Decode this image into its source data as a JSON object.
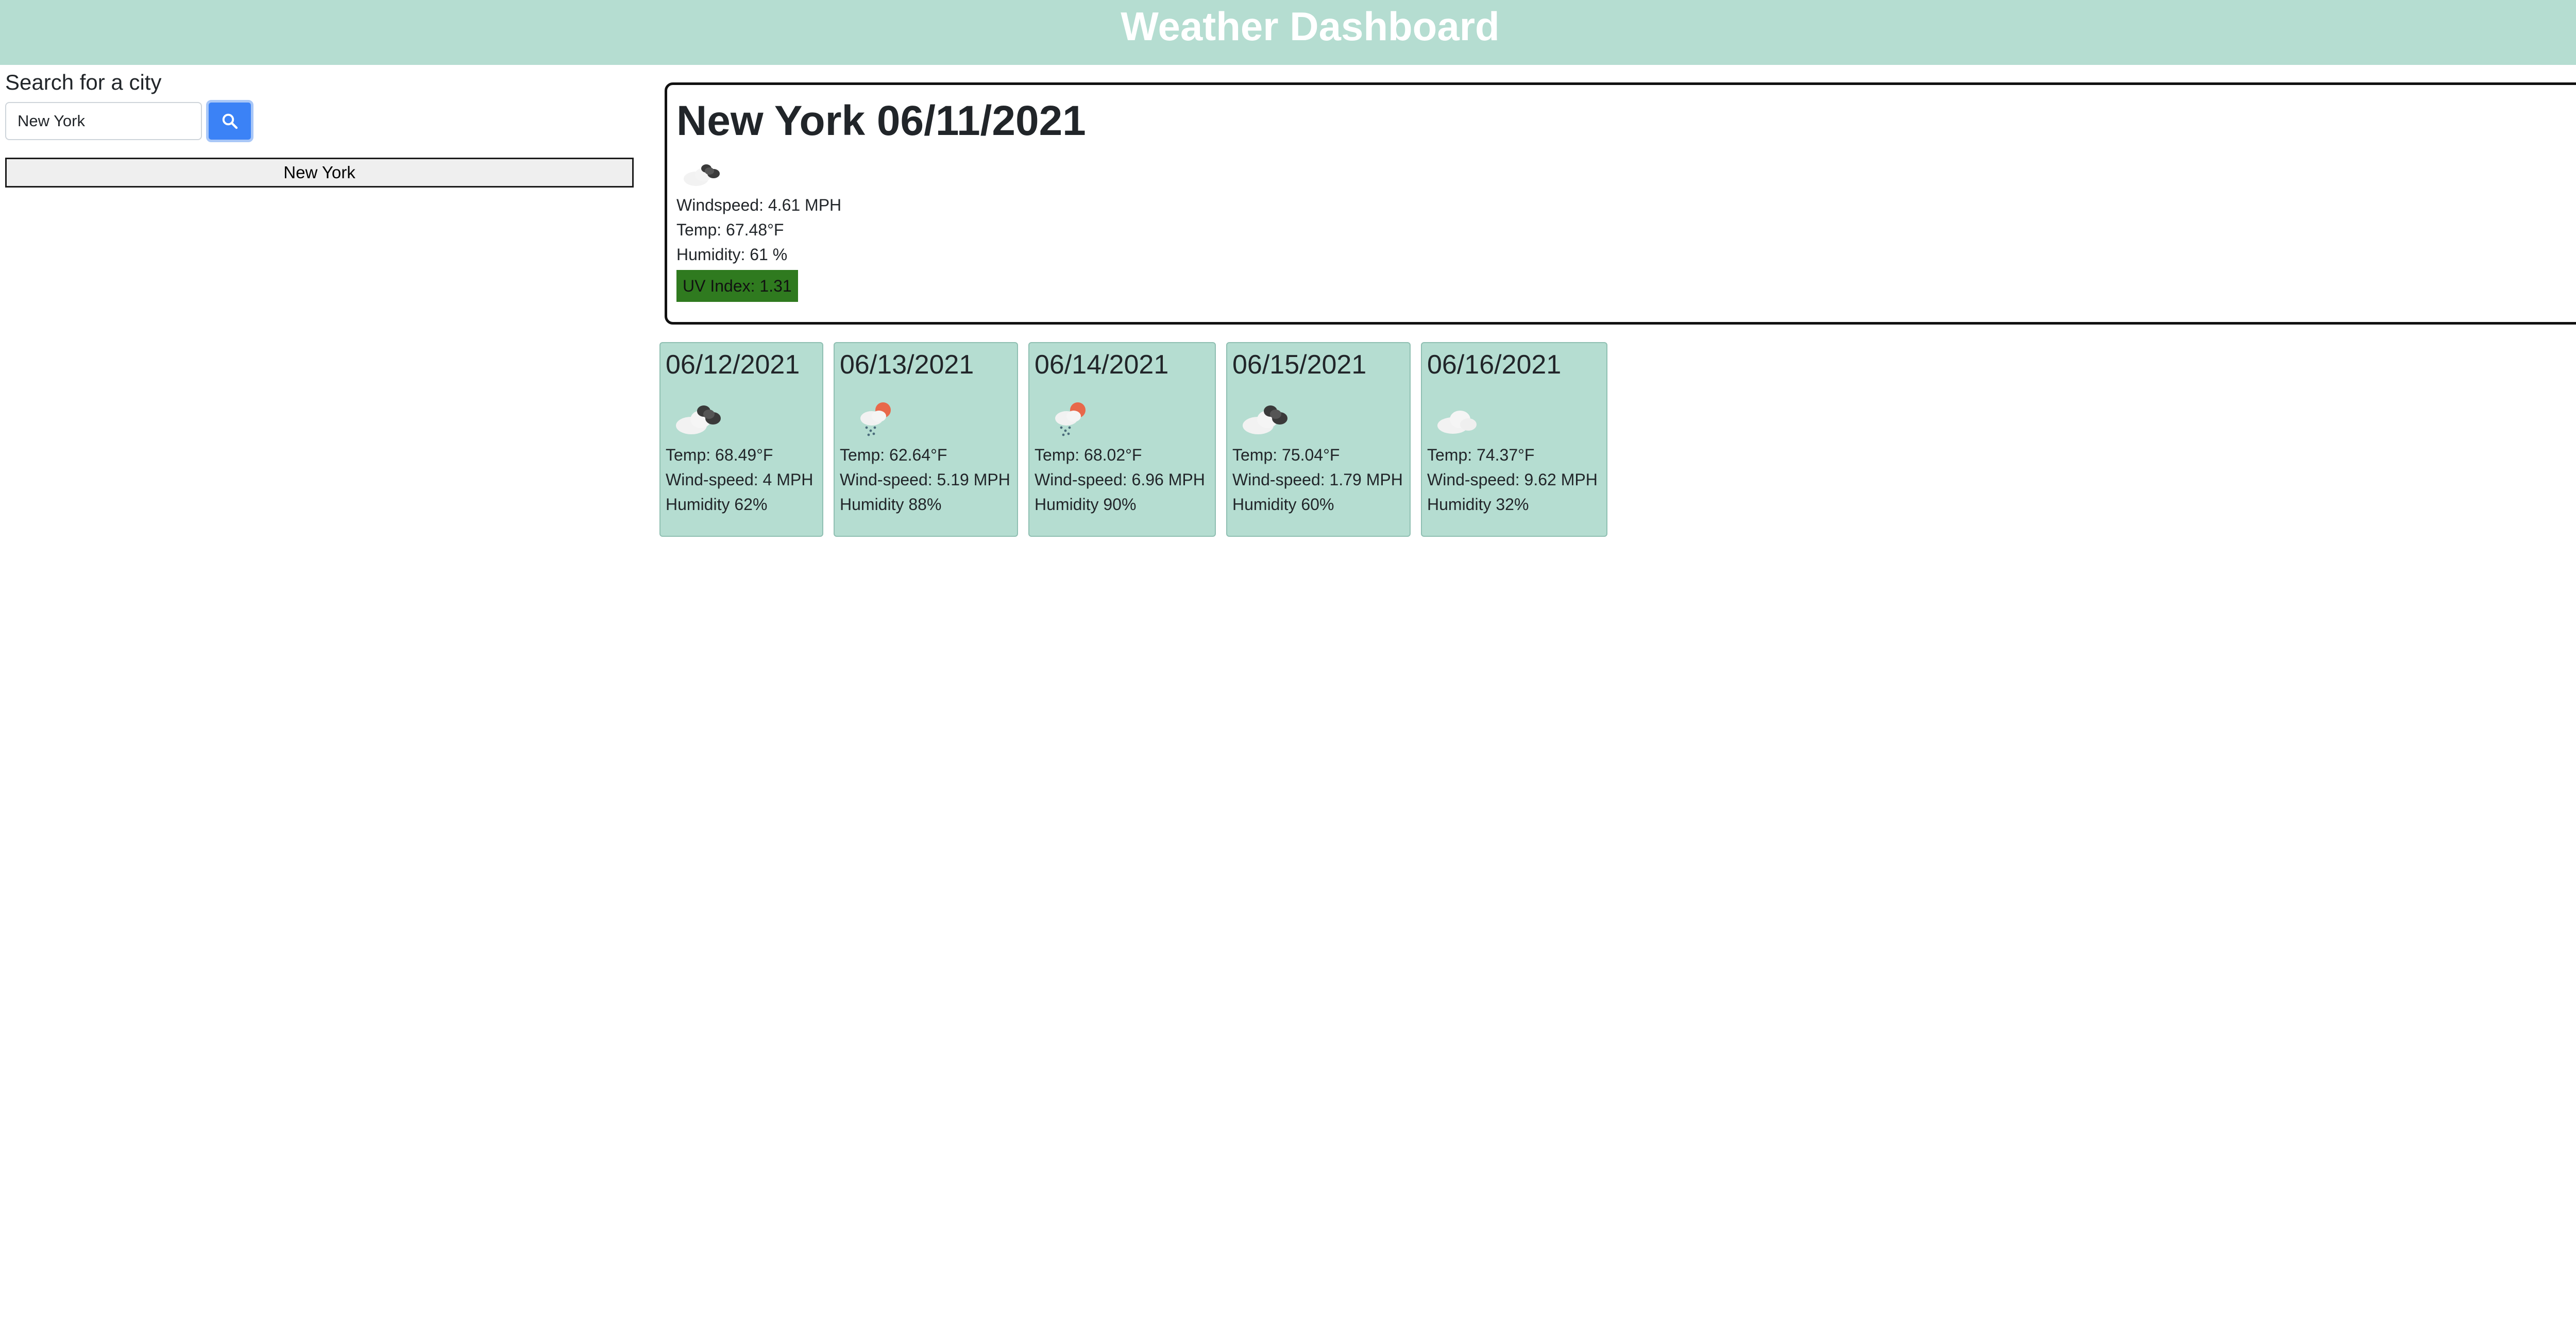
{
  "header": {
    "title": "Weather Dashboard"
  },
  "sidebar": {
    "search_label": "Search for a city",
    "search_value": "New York",
    "search_button_icon": "search-icon",
    "history": [
      "New York"
    ]
  },
  "current": {
    "title": "New York 06/11/2021",
    "icon": "cloudy-icon",
    "windspeed": "Windspeed: 4.61 MPH",
    "temp": "Temp: 67.48°F",
    "humidity": "Humidity: 61 %",
    "uv": "UV Index: 1.31",
    "uv_color": "#2f7a1f"
  },
  "forecast": [
    {
      "date": "06/12/2021",
      "icon": "broken-clouds-icon",
      "temp": "Temp: 68.49°F",
      "wind": "Wind-speed: 4 MPH",
      "humidity": "Humidity 62%"
    },
    {
      "date": "06/13/2021",
      "icon": "rain-sun-icon",
      "temp": "Temp: 62.64°F",
      "wind": "Wind-speed: 5.19 MPH",
      "humidity": "Humidity 88%"
    },
    {
      "date": "06/14/2021",
      "icon": "rain-sun-icon",
      "temp": "Temp: 68.02°F",
      "wind": "Wind-speed: 6.96 MPH",
      "humidity": "Humidity 90%"
    },
    {
      "date": "06/15/2021",
      "icon": "broken-clouds-icon",
      "temp": "Temp: 75.04°F",
      "wind": "Wind-speed: 1.79 MPH",
      "humidity": "Humidity 60%"
    },
    {
      "date": "06/16/2021",
      "icon": "cloud-icon",
      "temp": "Temp: 74.37°F",
      "wind": "Wind-speed: 9.62 MPH",
      "humidity": "Humidity 32%"
    }
  ],
  "colors": {
    "header_bg": "#b5ddd1",
    "card_bg": "#b5ddd1",
    "search_button": "#3b82f6"
  }
}
